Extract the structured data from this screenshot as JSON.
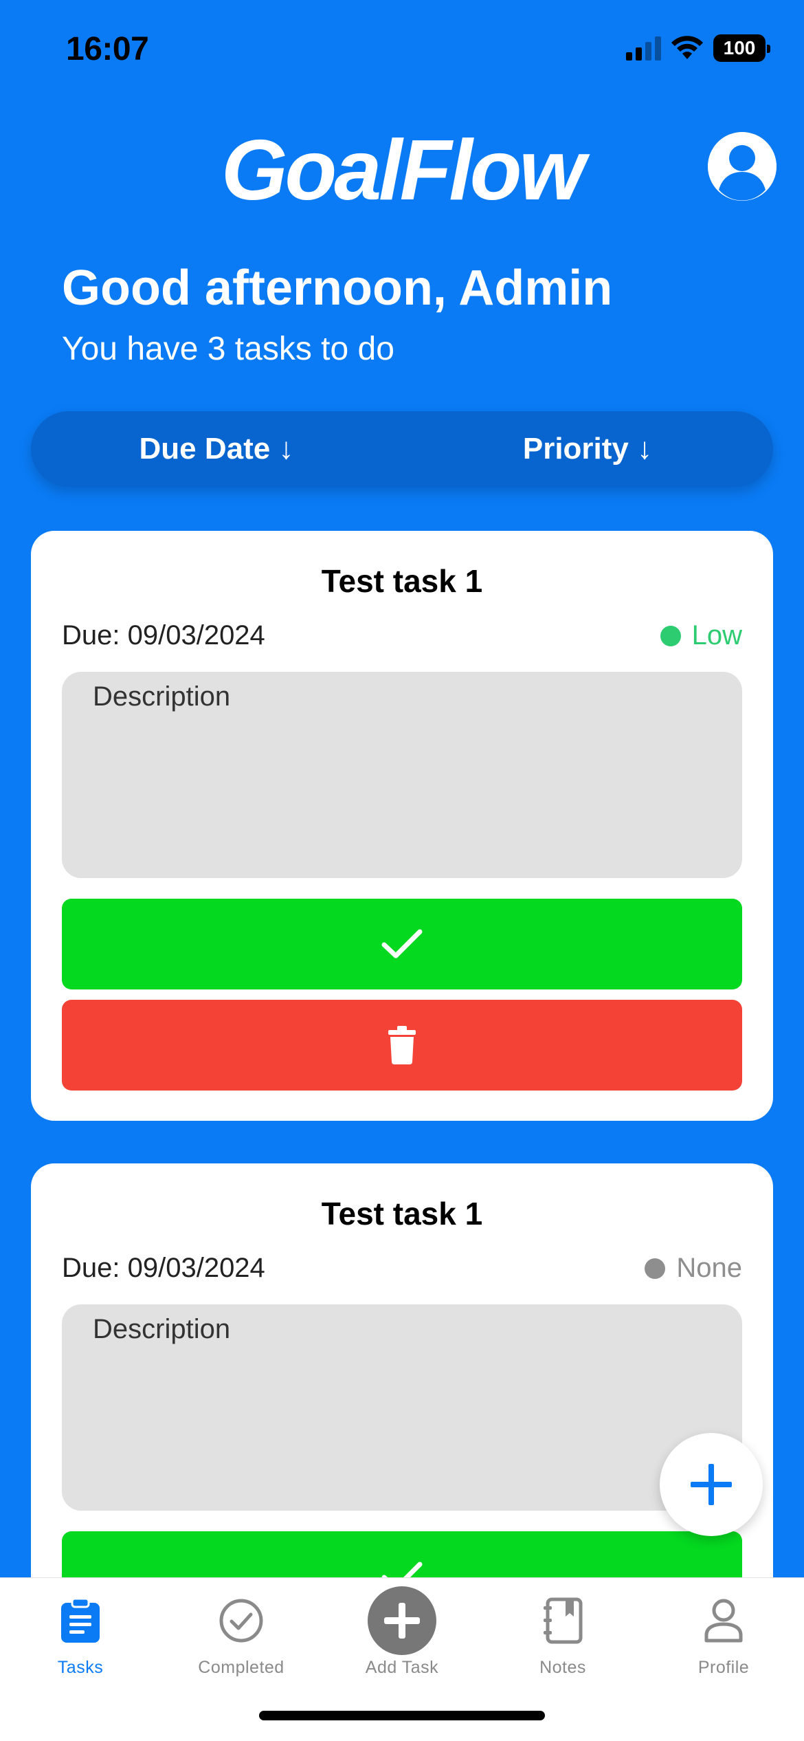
{
  "status_bar": {
    "time": "16:07",
    "battery": "100"
  },
  "header": {
    "app_name": "GoalFlow",
    "greeting": "Good afternoon, Admin",
    "subtitle": "You have 3 tasks to do"
  },
  "sort": {
    "due_date_label": "Due Date ↓",
    "priority_label": "Priority ↓"
  },
  "tasks": [
    {
      "title": "Test task 1",
      "due": "Due: 09/03/2024",
      "priority": "Low",
      "priority_color": "#2ECC71",
      "description_placeholder": "Description"
    },
    {
      "title": "Test task 1",
      "due": "Due: 09/03/2024",
      "priority": "None",
      "priority_color": "#8E8E8E",
      "description_placeholder": "Description"
    }
  ],
  "tab_bar": {
    "items": [
      {
        "label": "Tasks",
        "icon": "clipboard-icon",
        "active": true
      },
      {
        "label": "Completed",
        "icon": "check-circle-icon",
        "active": false
      },
      {
        "label": "Add Task",
        "icon": "plus-circle-icon",
        "active": false
      },
      {
        "label": "Notes",
        "icon": "notebook-icon",
        "active": false
      },
      {
        "label": "Profile",
        "icon": "person-icon",
        "active": false
      }
    ]
  },
  "colors": {
    "primary": "#0A7BF5",
    "complete": "#04D81F",
    "delete": "#F44336"
  }
}
